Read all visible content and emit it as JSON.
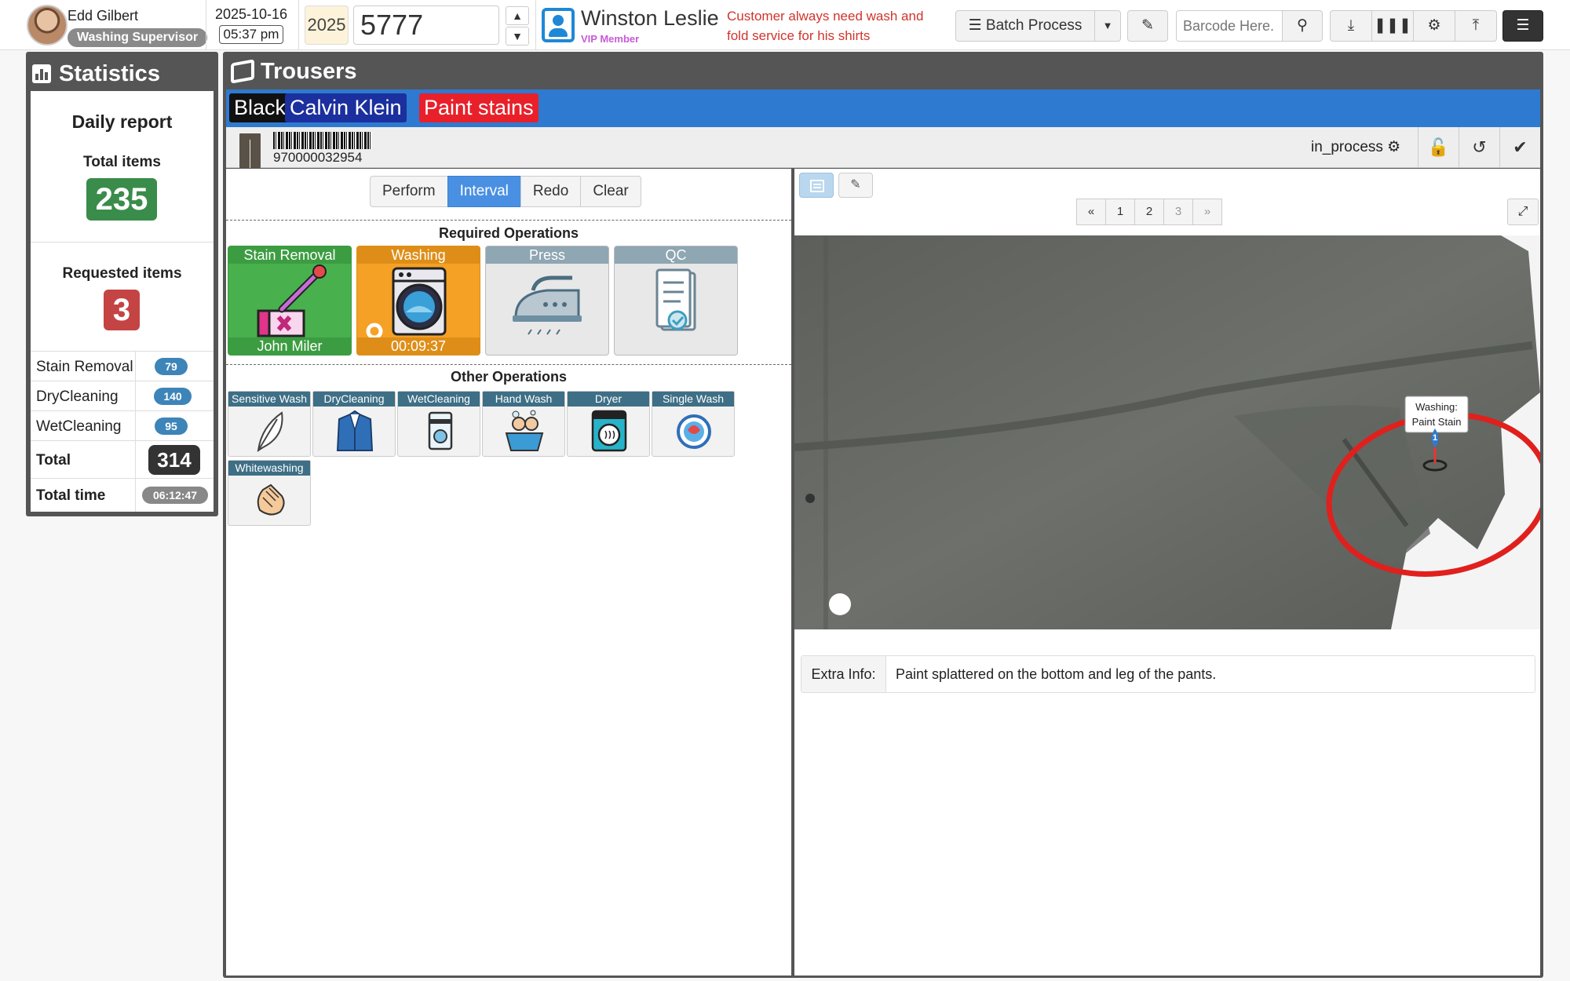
{
  "user": {
    "name": "Edd Gilbert",
    "role": "Washing Supervisor"
  },
  "datetime": {
    "date": "2025-10-16",
    "time": "05:37 pm"
  },
  "order": {
    "year": "2025",
    "number": "5777"
  },
  "customer": {
    "name": "Winston Leslie",
    "membership": "VIP Member",
    "note": "Customer always need wash and fold service for his shirts"
  },
  "toolbar": {
    "batch_label": "Batch Process",
    "barcode_placeholder": "Barcode Here."
  },
  "statistics": {
    "title": "Statistics",
    "daily_title": "Daily report",
    "total_items_label": "Total items",
    "total_items": "235",
    "requested_label": "Requested items",
    "requested": "3",
    "rows": [
      {
        "label": "Stain Removal",
        "value": "79"
      },
      {
        "label": "DryCleaning",
        "value": "140"
      },
      {
        "label": "WetCleaning",
        "value": "95"
      }
    ],
    "total_label": "Total",
    "total_value": "314",
    "time_label": "Total time",
    "time_value": "06:12:47"
  },
  "item": {
    "title": "Trousers",
    "tags": [
      {
        "label": "Black",
        "color": "#111111"
      },
      {
        "label": "Calvin Klein",
        "color": "#1b2f9e"
      },
      {
        "label": "Paint stains",
        "color": "#e8202a"
      }
    ],
    "barcode": "970000032954",
    "status": "in_process"
  },
  "modes": [
    "Perform",
    "Interval",
    "Redo",
    "Clear"
  ],
  "active_mode": "Interval",
  "required_title": "Required Operations",
  "required_ops": [
    {
      "label": "Stain Removal",
      "footer": "John Miler",
      "color": "#4caf50",
      "icon": "dropper-icon"
    },
    {
      "label": "Washing",
      "footer": "00:09:37",
      "color": "#f5a623",
      "icon": "washing-machine-icon"
    },
    {
      "label": "Press",
      "footer": "",
      "color": "#e6e6e6",
      "icon": "iron-icon"
    },
    {
      "label": "QC",
      "footer": "",
      "color": "#e6e6e6",
      "icon": "checklist-icon"
    }
  ],
  "other_title": "Other Operations",
  "other_ops": [
    {
      "label": "Sensitive Wash",
      "icon": "feather-icon"
    },
    {
      "label": "DryCleaning",
      "icon": "suit-icon"
    },
    {
      "label": "WetCleaning",
      "icon": "detergent-icon"
    },
    {
      "label": "Hand Wash",
      "icon": "hand-wash-icon"
    },
    {
      "label": "Dryer",
      "icon": "dryer-icon"
    },
    {
      "label": "Single Wash",
      "icon": "single-wash-icon"
    },
    {
      "label": "Whitewashing",
      "icon": "clap-hands-icon"
    }
  ],
  "pager": {
    "prev": "«",
    "pages": [
      "1",
      "2",
      "3"
    ],
    "next": "»"
  },
  "photo_marker": {
    "label_line1": "Washing:",
    "label_line2": "Paint Stain",
    "number": "1"
  },
  "extra_info": {
    "label": "Extra Info:",
    "text": "Paint splattered on the bottom and leg of the pants."
  }
}
